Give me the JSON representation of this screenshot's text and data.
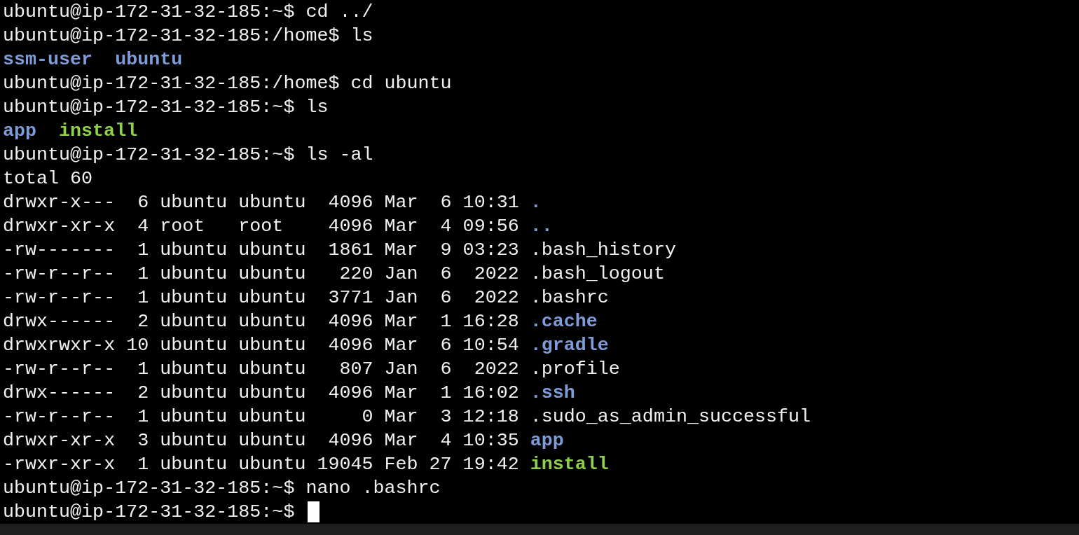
{
  "terminal": {
    "lines": [
      {
        "segments": [
          {
            "kind": "plain",
            "text": "ubuntu@ip-172-31-32-185:~$ cd ../"
          }
        ]
      },
      {
        "segments": [
          {
            "kind": "plain",
            "text": "ubuntu@ip-172-31-32-185:/home$ ls"
          }
        ]
      },
      {
        "segments": [
          {
            "kind": "dir",
            "text": "ssm-user"
          },
          {
            "kind": "sep"
          },
          {
            "kind": "dir",
            "text": "ubuntu"
          }
        ]
      },
      {
        "segments": [
          {
            "kind": "plain",
            "text": "ubuntu@ip-172-31-32-185:/home$ cd ubuntu"
          }
        ]
      },
      {
        "segments": [
          {
            "kind": "plain",
            "text": "ubuntu@ip-172-31-32-185:~$ ls"
          }
        ]
      },
      {
        "segments": [
          {
            "kind": "dir",
            "text": "app"
          },
          {
            "kind": "sep"
          },
          {
            "kind": "exec",
            "text": "install"
          }
        ]
      },
      {
        "segments": [
          {
            "kind": "plain",
            "text": "ubuntu@ip-172-31-32-185:~$ ls -al"
          }
        ]
      },
      {
        "segments": [
          {
            "kind": "plain",
            "text": "total 60"
          }
        ]
      },
      {
        "segments": [
          {
            "kind": "plain",
            "text": "drwxr-x---  6 ubuntu ubuntu  4096 Mar  6 10:31 "
          },
          {
            "kind": "dir",
            "text": "."
          }
        ]
      },
      {
        "segments": [
          {
            "kind": "plain",
            "text": "drwxr-xr-x  4 root   root    4096 Mar  4 09:56 "
          },
          {
            "kind": "dir",
            "text": ".."
          }
        ]
      },
      {
        "segments": [
          {
            "kind": "plain",
            "text": "-rw-------  1 ubuntu ubuntu  1861 Mar  9 03:23 .bash_history"
          }
        ]
      },
      {
        "segments": [
          {
            "kind": "plain",
            "text": "-rw-r--r--  1 ubuntu ubuntu   220 Jan  6  2022 .bash_logout"
          }
        ]
      },
      {
        "segments": [
          {
            "kind": "plain",
            "text": "-rw-r--r--  1 ubuntu ubuntu  3771 Jan  6  2022 .bashrc"
          }
        ]
      },
      {
        "segments": [
          {
            "kind": "plain",
            "text": "drwx------  2 ubuntu ubuntu  4096 Mar  1 16:28 "
          },
          {
            "kind": "dir",
            "text": ".cache"
          }
        ]
      },
      {
        "segments": [
          {
            "kind": "plain",
            "text": "drwxrwxr-x 10 ubuntu ubuntu  4096 Mar  6 10:54 "
          },
          {
            "kind": "dir",
            "text": ".gradle"
          }
        ]
      },
      {
        "segments": [
          {
            "kind": "plain",
            "text": "-rw-r--r--  1 ubuntu ubuntu   807 Jan  6  2022 .profile"
          }
        ]
      },
      {
        "segments": [
          {
            "kind": "plain",
            "text": "drwx------  2 ubuntu ubuntu  4096 Mar  1 16:02 "
          },
          {
            "kind": "dir",
            "text": ".ssh"
          }
        ]
      },
      {
        "segments": [
          {
            "kind": "plain",
            "text": "-rw-r--r--  1 ubuntu ubuntu     0 Mar  3 12:18 .sudo_as_admin_successful"
          }
        ]
      },
      {
        "segments": [
          {
            "kind": "plain",
            "text": "drwxr-xr-x  3 ubuntu ubuntu  4096 Mar  4 10:35 "
          },
          {
            "kind": "dir",
            "text": "app"
          }
        ]
      },
      {
        "segments": [
          {
            "kind": "plain",
            "text": "-rwxr-xr-x  1 ubuntu ubuntu 19045 Feb 27 19:42 "
          },
          {
            "kind": "exec",
            "text": "install"
          }
        ]
      },
      {
        "segments": [
          {
            "kind": "plain",
            "text": "ubuntu@ip-172-31-32-185:~$ nano .bashrc"
          }
        ]
      },
      {
        "segments": [
          {
            "kind": "plain",
            "text": "ubuntu@ip-172-31-32-185:~$ "
          }
        ],
        "cursor": true
      }
    ]
  }
}
